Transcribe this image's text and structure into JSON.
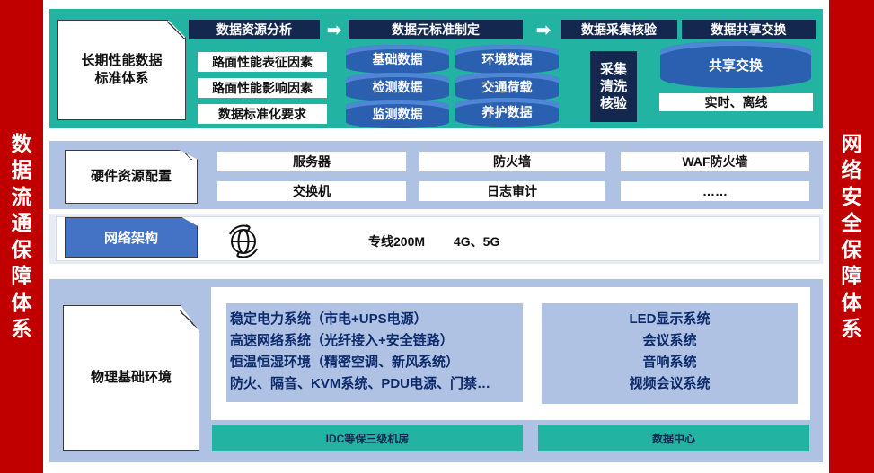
{
  "left_banner": "数据流通保障体系",
  "right_banner": "网络安全保障体系",
  "standards": {
    "title": "长期性能数据标准体系",
    "analysis": {
      "header": "数据资源分析",
      "items": [
        "路面性能表征因素",
        "路面性能影响因素",
        "数据标准化要求"
      ]
    },
    "metadata": {
      "header": "数据元标准制定",
      "items": [
        "基础数据",
        "环境数据",
        "检测数据",
        "交通荷载",
        "监测数据",
        "养护数据"
      ]
    },
    "collection": {
      "header": "数据采集核验",
      "body": "采集清洗核验"
    },
    "sharing": {
      "header": "数据共享交换",
      "cylinder": "共享交换",
      "mode": "实时、离线"
    }
  },
  "hardware": {
    "title": "硬件资源配置",
    "items": [
      "服务器",
      "防火墙",
      "WAF防火墙",
      "交换机",
      "日志审计",
      "……"
    ]
  },
  "network": {
    "title": "网络架构",
    "icon": "globe-sync-icon",
    "line": "专线200M",
    "mobile": "4G、5G"
  },
  "physical": {
    "title": "物理基础环境",
    "idc": {
      "lines": [
        "稳定电力系统（市电+UPS电源）",
        "高速网络系统（光纤接入+安全链路）",
        "恒温恒湿环境（精密空调、新风系统）",
        "防火、隔音、KVM系统、PDU电源、门禁…"
      ],
      "label": "IDC等保三级机房"
    },
    "datacenter": {
      "lines": [
        "LED显示系统",
        "会议系统",
        "音响系统",
        "视频会议系统"
      ],
      "label": "数据中心"
    }
  },
  "colors": {
    "banner_red": "#c00000",
    "teal": "#23b3a2",
    "navy": "#14284f",
    "cylinder_blue": "#2b5faf",
    "light_blue": "#b0c2e4",
    "button_blue": "#4472c4"
  }
}
